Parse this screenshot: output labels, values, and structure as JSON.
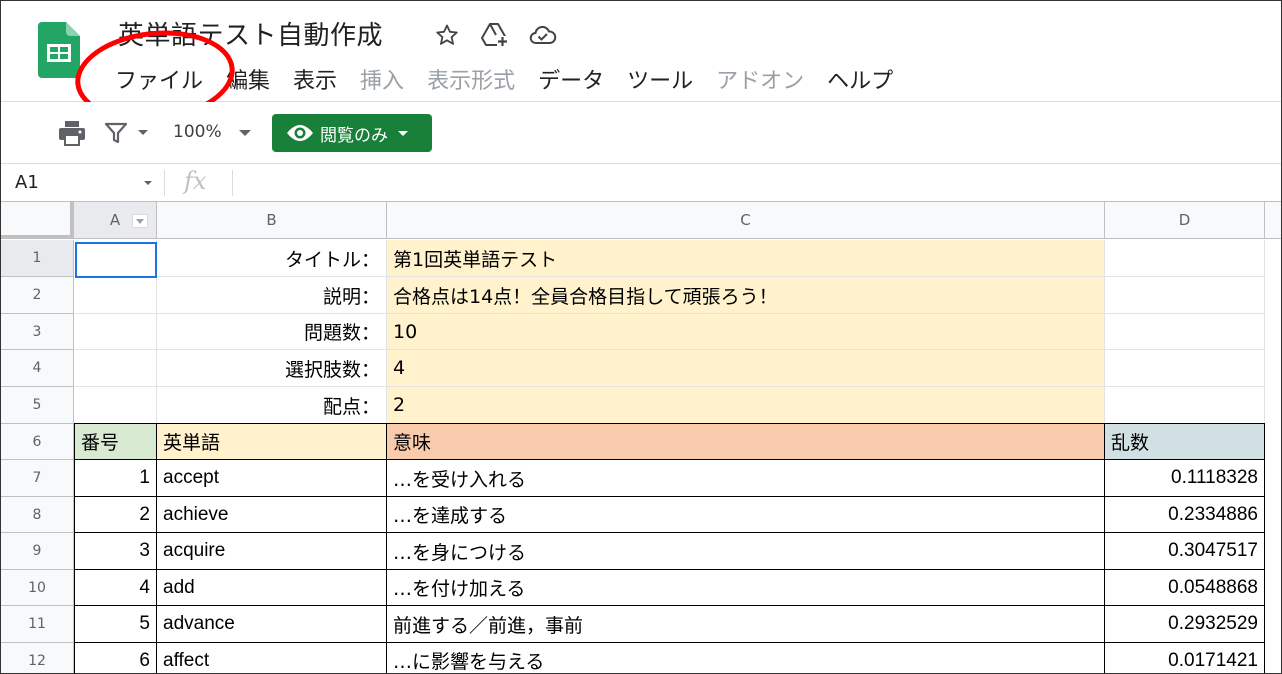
{
  "app": {
    "doc_title": "英単語テスト自動作成",
    "title_icons": [
      "star-icon",
      "move-to-drive-icon",
      "cloud-saved-icon"
    ]
  },
  "menu": [
    {
      "label": "ファイル",
      "enabled": true
    },
    {
      "label": "編集",
      "enabled": true
    },
    {
      "label": "表示",
      "enabled": true
    },
    {
      "label": "挿入",
      "enabled": false
    },
    {
      "label": "表示形式",
      "enabled": false
    },
    {
      "label": "データ",
      "enabled": true
    },
    {
      "label": "ツール",
      "enabled": true
    },
    {
      "label": "アドオン",
      "enabled": false
    },
    {
      "label": "ヘルプ",
      "enabled": true
    }
  ],
  "toolbar": {
    "zoom": "100%",
    "view_mode_label": "閲覧のみ",
    "accent": "#188038"
  },
  "formula_bar": {
    "name_box": "A1",
    "fx_label": "fx",
    "content": ""
  },
  "columns": [
    "A",
    "B",
    "C",
    "D"
  ],
  "rows": [
    "1",
    "2",
    "3",
    "4",
    "5",
    "6",
    "7",
    "8",
    "9",
    "10",
    "11",
    "12"
  ],
  "settings": [
    {
      "label": "タイトル：",
      "value": "第1回英単語テスト"
    },
    {
      "label": "説明：",
      "value": "合格点は14点！全員合格目指して頑張ろう！"
    },
    {
      "label": "問題数：",
      "value": "10"
    },
    {
      "label": "選択肢数：",
      "value": "4"
    },
    {
      "label": "配点：",
      "value": "2"
    }
  ],
  "table_header": {
    "num": "番号",
    "word": "英単語",
    "meaning": "意味",
    "random": "乱数"
  },
  "words": [
    {
      "num": "1",
      "word": "accept",
      "meaning": "…を受け入れる",
      "random": "0.1118328"
    },
    {
      "num": "2",
      "word": "achieve",
      "meaning": "…を達成する",
      "random": "0.2334886"
    },
    {
      "num": "3",
      "word": "acquire",
      "meaning": "…を身につける",
      "random": "0.3047517"
    },
    {
      "num": "4",
      "word": "add",
      "meaning": "…を付け加える",
      "random": "0.0548868"
    },
    {
      "num": "5",
      "word": "advance",
      "meaning": "前進する／前進，事前",
      "random": "0.2932529"
    },
    {
      "num": "6",
      "word": "affect",
      "meaning": "…に影響を与える",
      "random": "0.0171421"
    }
  ],
  "colors": {
    "settings_bg": "#fff2cc",
    "header_num_bg": "#d9ead3",
    "header_word_bg": "#fff2cc",
    "header_meaning_bg": "#f8cbad",
    "header_random_bg": "#d0e0e3",
    "annotation": "#ff0000"
  }
}
